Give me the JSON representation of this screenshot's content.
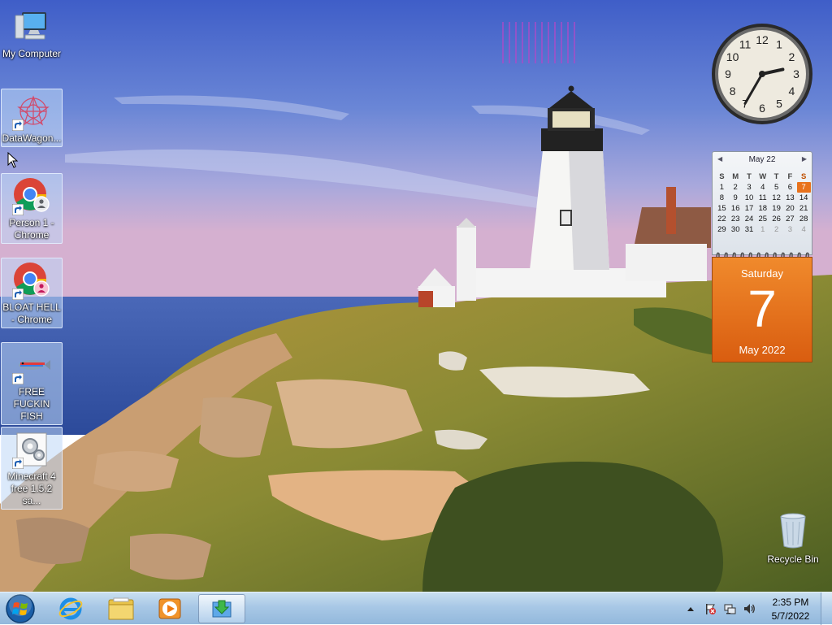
{
  "desktop": {
    "icons": [
      {
        "label": "My Computer",
        "icon": "computer-icon"
      },
      {
        "label": "DataWagon...",
        "icon": "datawagon-icon"
      },
      {
        "label": "Person 1 - Chrome",
        "icon": "chrome-icon"
      },
      {
        "label": "BLOAT HELL - Chrome",
        "icon": "chrome-icon"
      },
      {
        "label": "FREE FUCKIN FISH",
        "icon": "fish-icon"
      },
      {
        "label": "Minecraft 4 free 1.5.2 sa...",
        "icon": "installer-icon"
      }
    ],
    "recycle_bin": {
      "label": "Recycle Bin",
      "icon": "recycle-bin-icon"
    }
  },
  "clock_gadget": {
    "hour": 2,
    "minute": 35,
    "numerals": [
      "12",
      "1",
      "2",
      "3",
      "4",
      "5",
      "6",
      "7",
      "8",
      "9",
      "10",
      "11"
    ]
  },
  "calendar_gadget": {
    "month_title": "May 22",
    "weekday_headers": [
      "S",
      "M",
      "T",
      "W",
      "T",
      "F",
      "S"
    ],
    "weeks": [
      [
        "1",
        "2",
        "3",
        "4",
        "5",
        "6",
        "7"
      ],
      [
        "8",
        "9",
        "10",
        "11",
        "12",
        "13",
        "14"
      ],
      [
        "15",
        "16",
        "17",
        "18",
        "19",
        "20",
        "21"
      ],
      [
        "22",
        "23",
        "24",
        "25",
        "26",
        "27",
        "28"
      ],
      [
        "29",
        "30",
        "31",
        "1",
        "2",
        "3",
        "4"
      ]
    ],
    "today": "7",
    "day_name": "Saturday",
    "day_number": "7",
    "month_year": "May 2022"
  },
  "taskbar": {
    "pinned": [
      "internet-explorer-icon",
      "file-explorer-icon",
      "media-player-icon",
      "active-window-icon"
    ],
    "tray": {
      "time": "2:35 PM",
      "date": "5/7/2022"
    }
  },
  "colors": {
    "accent_orange": "#e8721c",
    "taskbar_blue": "#a8c8e6"
  }
}
